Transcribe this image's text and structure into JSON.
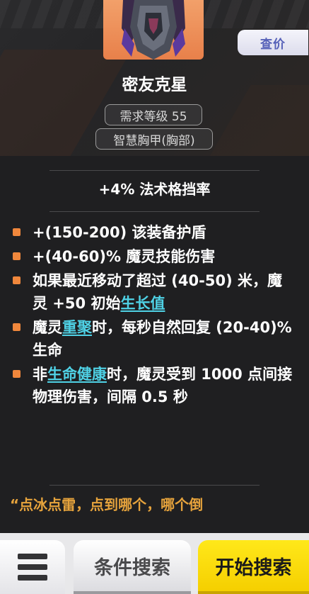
{
  "item": {
    "name": "密友克星",
    "level_req": "需求等级 55",
    "item_type": "智慧胸甲(胸部)",
    "price_button": "查价"
  },
  "implicit": "+4% 法术格挡率",
  "mods": [
    {
      "segments": [
        {
          "text": "+(150-200) 该装备护盾"
        }
      ]
    },
    {
      "segments": [
        {
          "text": "+(40-60)% 魔灵技能伤害"
        }
      ]
    },
    {
      "segments": [
        {
          "text": "如果最近移动了超过 (40-50) 米，魔灵 +50 初始"
        },
        {
          "text": "生长值",
          "keyword": true
        }
      ]
    },
    {
      "segments": [
        {
          "text": "魔灵"
        },
        {
          "text": "重聚",
          "keyword": true
        },
        {
          "text": "时，每秒自然回复 (20-40)% 生命"
        }
      ]
    },
    {
      "segments": [
        {
          "text": "非"
        },
        {
          "text": "生命健康",
          "keyword": true
        },
        {
          "text": "时，魔灵受到 1000 点间接物理伤害，间隔 0.5 秒"
        }
      ]
    }
  ],
  "flavor_text": "“点冰点雷，点到哪个，哪个倒",
  "bottom": {
    "menu_icon": "hamburger-menu-icon",
    "condition_search": "条件搜索",
    "start_search": "开始搜索"
  },
  "colors": {
    "bullet": "#f0873c",
    "keyword": "#4fd2e6",
    "flavor": "#e6a33c",
    "start_button": "#f5cf00",
    "price_button_text": "#5560b8",
    "icon_background": "#e8804a"
  }
}
